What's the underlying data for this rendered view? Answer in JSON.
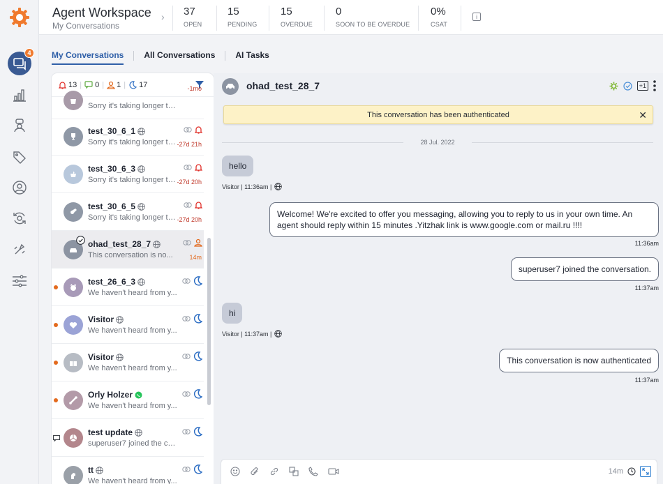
{
  "header": {
    "title": "Agent Workspace",
    "subtitle": "My Conversations",
    "stats": [
      {
        "value": "37",
        "label": "OPEN"
      },
      {
        "value": "15",
        "label": "PENDING"
      },
      {
        "value": "15",
        "label": "OVERDUE"
      },
      {
        "value": "0",
        "label": "SOON TO BE OVERDUE"
      },
      {
        "value": "0%",
        "label": "CSAT"
      }
    ]
  },
  "sidebar": {
    "badge": "4",
    "items": [
      "conversations-icon",
      "analytics-icon",
      "bot-icon",
      "tag-icon",
      "contact-icon",
      "sync-icon",
      "automation-icon",
      "settings-sliders-icon"
    ]
  },
  "tabs": [
    {
      "label": "My Conversations",
      "active": true
    },
    {
      "label": "All Conversations",
      "active": false
    },
    {
      "label": "AI Tasks",
      "active": false
    }
  ],
  "filters": {
    "alerts": "13",
    "messages": "0",
    "assigned": "1",
    "snoozed": "17"
  },
  "conversations": [
    {
      "name": "",
      "preview": "Sorry it's taking longer th...",
      "time": "-1mo",
      "avatar": "bag",
      "avatar_color": "#a89aa8",
      "channel": "web",
      "status": "",
      "unread": false
    },
    {
      "name": "test_30_6_1",
      "preview": "Sorry it's taking longer th...",
      "time": "-27d 21h",
      "avatar": "trophy",
      "avatar_color": "#8f98a6",
      "channel": "web",
      "status": "alert",
      "unread": false
    },
    {
      "name": "test_30_6_3",
      "preview": "Sorry it's taking longer th...",
      "time": "-27d 20h",
      "avatar": "teapot",
      "avatar_color": "#b8c8dc",
      "channel": "web",
      "status": "alert",
      "unread": false
    },
    {
      "name": "test_30_6_5",
      "preview": "Sorry it's taking longer th...",
      "time": "-27d 20h",
      "avatar": "guitar",
      "avatar_color": "#8f98a6",
      "channel": "web",
      "status": "alert",
      "unread": false
    },
    {
      "name": "ohad_test_28_7",
      "preview": "This conversation is no...",
      "time": "14m",
      "avatar": "car",
      "avatar_color": "#8c94a2",
      "channel": "web",
      "status": "assigned",
      "unread": false,
      "selected": true
    },
    {
      "name": "test_26_6_3",
      "preview": "We haven't heard from y...",
      "time": "",
      "avatar": "cat",
      "avatar_color": "#a89ab8",
      "channel": "web",
      "status": "snoozed",
      "unread": true
    },
    {
      "name": "Visitor",
      "preview": "We haven't heard from y...",
      "time": "",
      "avatar": "heart",
      "avatar_color": "#9ba3d6",
      "channel": "web",
      "status": "snoozed",
      "unread": true
    },
    {
      "name": "Visitor",
      "preview": "We haven't heard from y...",
      "time": "",
      "avatar": "gift",
      "avatar_color": "#b7bcc4",
      "channel": "web",
      "status": "snoozed",
      "unread": true
    },
    {
      "name": "Orly Holzer",
      "preview": "We haven't heard from y...",
      "time": "",
      "avatar": "bone",
      "avatar_color": "#b39aa8",
      "channel": "whatsapp",
      "status": "snoozed",
      "unread": true
    },
    {
      "name": "test update",
      "preview": "superuser7 joined the co...",
      "time": "",
      "avatar": "volleyball",
      "avatar_color": "#b3868c",
      "channel": "web",
      "status": "snoozed",
      "unread": false,
      "chat_marker": true
    },
    {
      "name": "tt",
      "preview": "We haven't heard from y...",
      "time": "",
      "avatar": "horse",
      "avatar_color": "#9aa0a8",
      "channel": "web",
      "status": "snoozed",
      "unread": false
    }
  ],
  "chat": {
    "name": "ohad_test_28_7",
    "banner": "This conversation has been authenticated",
    "date": "28 Jul. 2022",
    "messages": [
      {
        "dir": "in",
        "text": "hello",
        "meta": "Visitor  |  11:36am  |"
      },
      {
        "dir": "out",
        "text": "Welcome! We're excited to offer you messaging, allowing you to reply to us in your own time. An agent should reply within 15 minutes .Yitzhak link is www.google.com or mail.ru !!!!",
        "meta": "11:36am"
      },
      {
        "dir": "out",
        "text": "superuser7 joined the conversation.",
        "meta": "11:37am"
      },
      {
        "dir": "in",
        "text": "hi",
        "meta": "Visitor  |  11:37am  |"
      },
      {
        "dir": "out",
        "text": "This conversation is now authenticated",
        "meta": "11:37am"
      }
    ],
    "plus_label": "+1",
    "composer_timer": "14m"
  },
  "colors": {
    "accent": "#2f5fa8",
    "badge": "#f07a2e",
    "alert": "#e0312b",
    "snooze": "#2f6fc4",
    "banner": "#fdf2c7"
  }
}
